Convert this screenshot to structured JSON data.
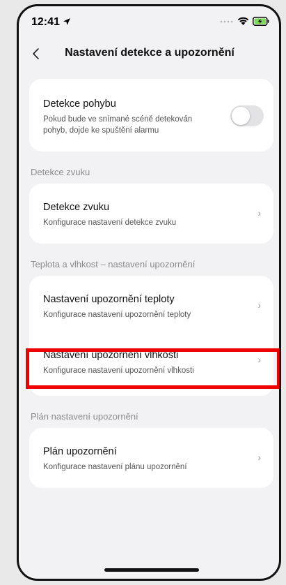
{
  "status_bar": {
    "time": "12:41"
  },
  "navbar": {
    "title": "Nastavení detekce a upozornění"
  },
  "motion": {
    "title": "Detekce pohybu",
    "description_line1": "Pokud bude ve snímané scéně detekován",
    "description_line2": "pohyb, dojde ke spuštění alarmu",
    "enabled": false
  },
  "sections": {
    "sound": "Detekce zvuku",
    "temp_humidity": "Teplota a vlhkost – nastavení upozornění",
    "schedule": "Plán nastavení upozornění"
  },
  "sound_detection": {
    "title": "Detekce zvuku",
    "subtitle": "Konfigurace nastavení detekce zvuku"
  },
  "temperature_alert": {
    "title": "Nastavení upozornění teploty",
    "subtitle": "Konfigurace nastavení upozornění teploty"
  },
  "humidity_alert": {
    "title": "Nastavení upozornění vlhkosti",
    "subtitle": "Konfigurace nastavení upozornění vlhkosti"
  },
  "alert_schedule": {
    "title": "Plán upozornění",
    "subtitle": "Konfigurace nastavení plánu upozornění"
  },
  "colors": {
    "highlight": "#ee0000",
    "background": "#f2f2f4",
    "card": "#ffffff"
  }
}
